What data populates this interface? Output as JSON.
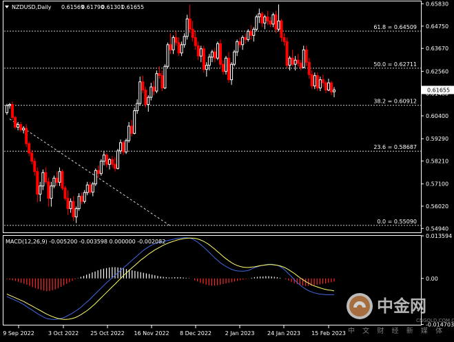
{
  "colors": {
    "background": "#000000",
    "grid": "#ffffff",
    "bull": "#ffffff",
    "bear": "#ff0000",
    "macd_line": "#4169e1",
    "signal_line": "#ffff66",
    "hist_pos": "#ffffff",
    "hist_neg": "#ff2a2a",
    "price_tag_bg": "#ffffff",
    "price_tag_fg": "#000000"
  },
  "watermark": {
    "brand": "中金网",
    "domain": "CNGOLD.COM.CN",
    "tagline": "中 文 财 经 新 媒 体"
  },
  "chart_data": [
    {
      "type": "candlestick",
      "symbol_title": "NZDUSD,Daily",
      "ohlc_header": [
        "0.61569",
        "0.61790",
        "0.61301",
        "0.61655"
      ],
      "last_price": "0.61655",
      "ylim": [
        0.5475,
        0.6595
      ],
      "y_ticks": [
        "0.65830",
        "0.64750",
        "0.63670",
        "0.62560",
        "0.61480",
        "0.60400",
        "0.59290",
        "0.58210",
        "0.57100",
        "0.56020",
        "0.54940"
      ],
      "x_ticks": [
        "9 Sep 2022",
        "3 Oct 2022",
        "25 Oct 2022",
        "16 Nov 2022",
        "8 Dec 2022",
        "2 Jan 2023",
        "24 Jan 2023",
        "15 Feb 2023"
      ],
      "fibonacci": [
        {
          "label": "61.8 = 0.64509",
          "level": 0.64509
        },
        {
          "label": "50.0 = 0.62711",
          "level": 0.62711
        },
        {
          "label": "38.2 = 0.60912",
          "level": 0.60912
        },
        {
          "label": "23.6 = 0.58687",
          "level": 0.58687
        },
        {
          "label": "0.0 = 0.55090",
          "level": 0.5509
        }
      ],
      "trendline": {
        "from": [
          0,
          0.6025
        ],
        "to": [
          1,
          0.5505
        ]
      },
      "candles": [
        [
          0.6055,
          0.6098,
          0.6045,
          0.609
        ],
        [
          0.609,
          0.6102,
          0.6075,
          0.6095
        ],
        [
          0.6095,
          0.611,
          0.602,
          0.6032
        ],
        [
          0.6032,
          0.604,
          0.5975,
          0.5985
        ],
        [
          0.5985,
          0.601,
          0.597,
          0.5998
        ],
        [
          0.5998,
          0.601,
          0.596,
          0.5972
        ],
        [
          0.5972,
          0.599,
          0.5955,
          0.598
        ],
        [
          0.598,
          0.6,
          0.589,
          0.5905
        ],
        [
          0.5905,
          0.5915,
          0.5845,
          0.586
        ],
        [
          0.586,
          0.5875,
          0.5805,
          0.582
        ],
        [
          0.582,
          0.5835,
          0.575,
          0.577
        ],
        [
          0.577,
          0.579,
          0.562,
          0.566
        ],
        [
          0.566,
          0.572,
          0.5625,
          0.57
        ],
        [
          0.57,
          0.578,
          0.568,
          0.5765
        ],
        [
          0.5765,
          0.579,
          0.571,
          0.572
        ],
        [
          0.572,
          0.574,
          0.56,
          0.564
        ],
        [
          0.564,
          0.572,
          0.56,
          0.57
        ],
        [
          0.57,
          0.575,
          0.569,
          0.5738
        ],
        [
          0.5738,
          0.577,
          0.57,
          0.5718
        ],
        [
          0.5718,
          0.579,
          0.57,
          0.577
        ],
        [
          0.577,
          0.578,
          0.568,
          0.569
        ],
        [
          0.569,
          0.57,
          0.563,
          0.564
        ],
        [
          0.564,
          0.568,
          0.556,
          0.559
        ],
        [
          0.559,
          0.564,
          0.557,
          0.5625
        ],
        [
          0.5625,
          0.565,
          0.553,
          0.555
        ],
        [
          0.555,
          0.56,
          0.552,
          0.559
        ],
        [
          0.559,
          0.5665,
          0.558,
          0.565
        ],
        [
          0.565,
          0.567,
          0.561,
          0.5625
        ],
        [
          0.5625,
          0.568,
          0.5615,
          0.5668
        ],
        [
          0.5668,
          0.572,
          0.5655,
          0.5705
        ],
        [
          0.5705,
          0.572,
          0.566,
          0.567
        ],
        [
          0.567,
          0.572,
          0.565,
          0.571
        ],
        [
          0.571,
          0.5785,
          0.57,
          0.5775
        ],
        [
          0.5775,
          0.58,
          0.574,
          0.576
        ],
        [
          0.576,
          0.583,
          0.575,
          0.582
        ],
        [
          0.582,
          0.587,
          0.58,
          0.585
        ],
        [
          0.585,
          0.586,
          0.579,
          0.5805
        ],
        [
          0.5805,
          0.5835,
          0.578,
          0.5828
        ],
        [
          0.5828,
          0.5845,
          0.579,
          0.5805
        ],
        [
          0.5805,
          0.584,
          0.577,
          0.5785
        ],
        [
          0.5785,
          0.588,
          0.578,
          0.587
        ],
        [
          0.587,
          0.5925,
          0.5855,
          0.591
        ],
        [
          0.591,
          0.592,
          0.585,
          0.5865
        ],
        [
          0.5865,
          0.593,
          0.5855,
          0.592
        ],
        [
          0.592,
          0.601,
          0.591,
          0.599
        ],
        [
          0.599,
          0.602,
          0.594,
          0.5955
        ],
        [
          0.5955,
          0.608,
          0.595,
          0.6065
        ],
        [
          0.6065,
          0.612,
          0.605,
          0.61
        ],
        [
          0.61,
          0.623,
          0.609,
          0.6205
        ],
        [
          0.6205,
          0.6235,
          0.615,
          0.6165
        ],
        [
          0.6165,
          0.618,
          0.608,
          0.6095
        ],
        [
          0.6095,
          0.614,
          0.606,
          0.613
        ],
        [
          0.613,
          0.62,
          0.6115,
          0.618
        ],
        [
          0.618,
          0.621,
          0.614,
          0.616
        ],
        [
          0.616,
          0.626,
          0.615,
          0.6245
        ],
        [
          0.6245,
          0.628,
          0.622,
          0.6235
        ],
        [
          0.6235,
          0.626,
          0.616,
          0.6175
        ],
        [
          0.6175,
          0.629,
          0.617,
          0.628
        ],
        [
          0.628,
          0.6395,
          0.627,
          0.6385
        ],
        [
          0.6385,
          0.644,
          0.634,
          0.636
        ],
        [
          0.636,
          0.643,
          0.634,
          0.642
        ],
        [
          0.642,
          0.645,
          0.638,
          0.6395
        ],
        [
          0.6395,
          0.642,
          0.633,
          0.6345
        ],
        [
          0.6345,
          0.64,
          0.633,
          0.6385
        ],
        [
          0.6385,
          0.644,
          0.637,
          0.6425
        ],
        [
          0.6425,
          0.653,
          0.641,
          0.651
        ],
        [
          0.651,
          0.658,
          0.644,
          0.646
        ],
        [
          0.646,
          0.65,
          0.64,
          0.642
        ],
        [
          0.642,
          0.645,
          0.636,
          0.638
        ],
        [
          0.638,
          0.64,
          0.631,
          0.633
        ],
        [
          0.633,
          0.638,
          0.63,
          0.6365
        ],
        [
          0.6365,
          0.638,
          0.625,
          0.6265
        ],
        [
          0.6265,
          0.63,
          0.623,
          0.6285
        ],
        [
          0.6285,
          0.634,
          0.626,
          0.6325
        ],
        [
          0.6325,
          0.636,
          0.63,
          0.635
        ],
        [
          0.635,
          0.637,
          0.63,
          0.632
        ],
        [
          0.632,
          0.64,
          0.631,
          0.639
        ],
        [
          0.639,
          0.641,
          0.627,
          0.629
        ],
        [
          0.629,
          0.631,
          0.624,
          0.6255
        ],
        [
          0.6255,
          0.633,
          0.624,
          0.632
        ],
        [
          0.632,
          0.635,
          0.62,
          0.6215
        ],
        [
          0.6215,
          0.63,
          0.619,
          0.629
        ],
        [
          0.629,
          0.636,
          0.628,
          0.635
        ],
        [
          0.635,
          0.641,
          0.633,
          0.64
        ],
        [
          0.64,
          0.642,
          0.637,
          0.6385
        ],
        [
          0.6385,
          0.643,
          0.636,
          0.642
        ],
        [
          0.642,
          0.644,
          0.639,
          0.641
        ],
        [
          0.641,
          0.646,
          0.64,
          0.645
        ],
        [
          0.645,
          0.648,
          0.641,
          0.643
        ],
        [
          0.643,
          0.647,
          0.64,
          0.646
        ],
        [
          0.646,
          0.653,
          0.645,
          0.652
        ],
        [
          0.652,
          0.656,
          0.649,
          0.6535
        ],
        [
          0.6535,
          0.6545,
          0.647,
          0.649
        ],
        [
          0.649,
          0.653,
          0.646,
          0.652
        ],
        [
          0.652,
          0.655,
          0.648,
          0.65
        ],
        [
          0.65,
          0.652,
          0.647,
          0.6485
        ],
        [
          0.6485,
          0.654,
          0.647,
          0.653
        ],
        [
          0.653,
          0.655,
          0.644,
          0.646
        ],
        [
          0.646,
          0.658,
          0.645,
          0.65
        ],
        [
          0.65,
          0.651,
          0.64,
          0.642
        ],
        [
          0.642,
          0.644,
          0.638,
          0.64
        ],
        [
          0.64,
          0.642,
          0.627,
          0.6285
        ],
        [
          0.6285,
          0.633,
          0.626,
          0.632
        ],
        [
          0.632,
          0.636,
          0.628,
          0.629
        ],
        [
          0.629,
          0.633,
          0.626,
          0.631
        ],
        [
          0.631,
          0.634,
          0.628,
          0.6295
        ],
        [
          0.6295,
          0.631,
          0.626,
          0.6275
        ],
        [
          0.6275,
          0.638,
          0.627,
          0.636
        ],
        [
          0.636,
          0.638,
          0.628,
          0.63
        ],
        [
          0.63,
          0.632,
          0.622,
          0.624
        ],
        [
          0.624,
          0.626,
          0.617,
          0.6185
        ],
        [
          0.6185,
          0.625,
          0.617,
          0.6235
        ],
        [
          0.6235,
          0.625,
          0.616,
          0.6175
        ],
        [
          0.6175,
          0.623,
          0.616,
          0.6215
        ],
        [
          0.6215,
          0.624,
          0.618,
          0.62
        ],
        [
          0.62,
          0.621,
          0.615,
          0.6165
        ],
        [
          0.6165,
          0.622,
          0.616,
          0.62
        ],
        [
          0.62,
          0.621,
          0.614,
          0.6155
        ],
        [
          0.61569,
          0.6179,
          0.61301,
          0.61655
        ]
      ]
    },
    {
      "type": "bar",
      "title": "MACD(12,26,9) -0.005200 -0.003598 0.000000 -0.002082",
      "ylim": [
        -0.0148,
        0.0136
      ],
      "y_ticks": [
        "0.013594",
        "0.00",
        "-0.014703"
      ],
      "series": [
        {
          "name": "histogram",
          "values": [
            -0.0002,
            -0.0004,
            -0.0006,
            -0.0008,
            -0.0011,
            -0.0014,
            -0.0017,
            -0.002,
            -0.0024,
            -0.0028,
            -0.0031,
            -0.0034,
            -0.0037,
            -0.0039,
            -0.0041,
            -0.004,
            -0.0038,
            -0.0035,
            -0.0031,
            -0.0027,
            -0.0022,
            -0.0017,
            -0.0012,
            -0.0008,
            -0.0003,
            0.0001,
            0.0005,
            0.0008,
            0.0012,
            0.0015,
            0.0019,
            0.0022,
            0.0026,
            0.0029,
            0.0031,
            0.0033,
            0.0035,
            0.0036,
            0.0036,
            0.0035,
            0.0034,
            0.0032,
            0.003,
            0.0028,
            0.0026,
            0.0024,
            0.0022,
            0.002,
            0.0018,
            0.0016,
            0.0014,
            0.0012,
            0.001,
            0.0008,
            0.0006,
            0.0005,
            0.0004,
            0.0003,
            0.0003,
            0.0004,
            0.0004,
            0.0004,
            0.0003,
            0.0002,
            0.0001,
            0.0,
            -0.0006,
            -0.001,
            -0.0014,
            -0.0017,
            -0.002,
            -0.0022,
            -0.0023,
            -0.0023,
            -0.0022,
            -0.002,
            -0.0018,
            -0.0016,
            -0.0014,
            -0.0012,
            -0.001,
            -0.0008,
            -0.0006,
            -0.0004,
            -0.0002,
            -0.0001,
            0.0002,
            0.0004,
            0.0005,
            0.0006,
            0.0006,
            0.0007,
            0.0007,
            0.0006,
            0.0005,
            0.0004,
            0.0002,
            0.0,
            -0.0003,
            -0.0007,
            -0.0011,
            -0.0015,
            -0.0018,
            -0.0021,
            -0.0023,
            -0.0024,
            -0.0024,
            -0.0023,
            -0.0022,
            -0.002,
            -0.0019,
            -0.0017,
            -0.0016,
            -0.0014,
            -0.0012,
            -0.001
          ]
        },
        {
          "name": "macd",
          "values": [
            -0.0058,
            -0.0062,
            -0.0066,
            -0.007,
            -0.0074,
            -0.0079,
            -0.0084,
            -0.009,
            -0.0096,
            -0.0102,
            -0.0108,
            -0.0114,
            -0.0119,
            -0.0124,
            -0.0128,
            -0.013,
            -0.0131,
            -0.0131,
            -0.013,
            -0.0128,
            -0.0125,
            -0.0121,
            -0.0116,
            -0.0111,
            -0.0105,
            -0.0099,
            -0.0092,
            -0.0084,
            -0.0076,
            -0.0068,
            -0.0059,
            -0.005,
            -0.0041,
            -0.0032,
            -0.0023,
            -0.0014,
            -0.0006,
            0.0002,
            0.001,
            0.0018,
            0.0026,
            0.0034,
            0.0042,
            0.005,
            0.0058,
            0.0066,
            0.0074,
            0.0082,
            0.009,
            0.0096,
            0.0102,
            0.0107,
            0.0111,
            0.0114,
            0.0116,
            0.0118,
            0.012,
            0.0122,
            0.0124,
            0.0126,
            0.0128,
            0.0129,
            0.013,
            0.013,
            0.0129,
            0.0127,
            0.0122,
            0.0116,
            0.0109,
            0.0101,
            0.0093,
            0.0084,
            0.0075,
            0.0066,
            0.0058,
            0.005,
            0.0044,
            0.0038,
            0.0033,
            0.0029,
            0.0026,
            0.0024,
            0.0023,
            0.0023,
            0.0024,
            0.0026,
            0.003,
            0.0034,
            0.0037,
            0.004,
            0.0042,
            0.0044,
            0.0045,
            0.0045,
            0.0044,
            0.0042,
            0.0038,
            0.0032,
            0.0024,
            0.0015,
            0.0006,
            -0.0004,
            -0.0013,
            -0.0021,
            -0.0028,
            -0.0034,
            -0.0039,
            -0.0043,
            -0.0046,
            -0.0048,
            -0.005,
            -0.0051,
            -0.0052,
            -0.0052,
            -0.0052,
            -0.0052
          ]
        },
        {
          "name": "signal",
          "values": [
            -0.005,
            -0.0054,
            -0.0058,
            -0.0062,
            -0.0066,
            -0.007,
            -0.0074,
            -0.0079,
            -0.0084,
            -0.0089,
            -0.0094,
            -0.0099,
            -0.0104,
            -0.0109,
            -0.0114,
            -0.0118,
            -0.0122,
            -0.0125,
            -0.0128,
            -0.013,
            -0.0131,
            -0.0131,
            -0.013,
            -0.0128,
            -0.0125,
            -0.0121,
            -0.0116,
            -0.011,
            -0.0104,
            -0.0097,
            -0.0089,
            -0.0081,
            -0.0072,
            -0.0063,
            -0.0054,
            -0.0045,
            -0.0036,
            -0.0027,
            -0.0018,
            -0.0009,
            0.0,
            0.0009,
            0.0018,
            0.0026,
            0.0034,
            0.0042,
            0.005,
            0.0058,
            0.0065,
            0.0072,
            0.0079,
            0.0085,
            0.0091,
            0.0096,
            0.0101,
            0.0106,
            0.011,
            0.0114,
            0.0117,
            0.012,
            0.0123,
            0.0125,
            0.0127,
            0.0128,
            0.0129,
            0.0129,
            0.0128,
            0.0126,
            0.0123,
            0.0119,
            0.0114,
            0.0108,
            0.0101,
            0.0094,
            0.0086,
            0.0078,
            0.007,
            0.0063,
            0.0056,
            0.005,
            0.0045,
            0.0041,
            0.0038,
            0.0036,
            0.0035,
            0.0035,
            0.0036,
            0.0037,
            0.0039,
            0.0041,
            0.0042,
            0.0043,
            0.0044,
            0.0044,
            0.0043,
            0.0042,
            0.004,
            0.0037,
            0.0033,
            0.0028,
            0.0022,
            0.0016,
            0.0009,
            0.0002,
            -0.0004,
            -0.001,
            -0.0015,
            -0.002,
            -0.0024,
            -0.0027,
            -0.003,
            -0.0033,
            -0.0035,
            -0.0037,
            -0.0038,
            -0.004
          ]
        }
      ]
    }
  ]
}
